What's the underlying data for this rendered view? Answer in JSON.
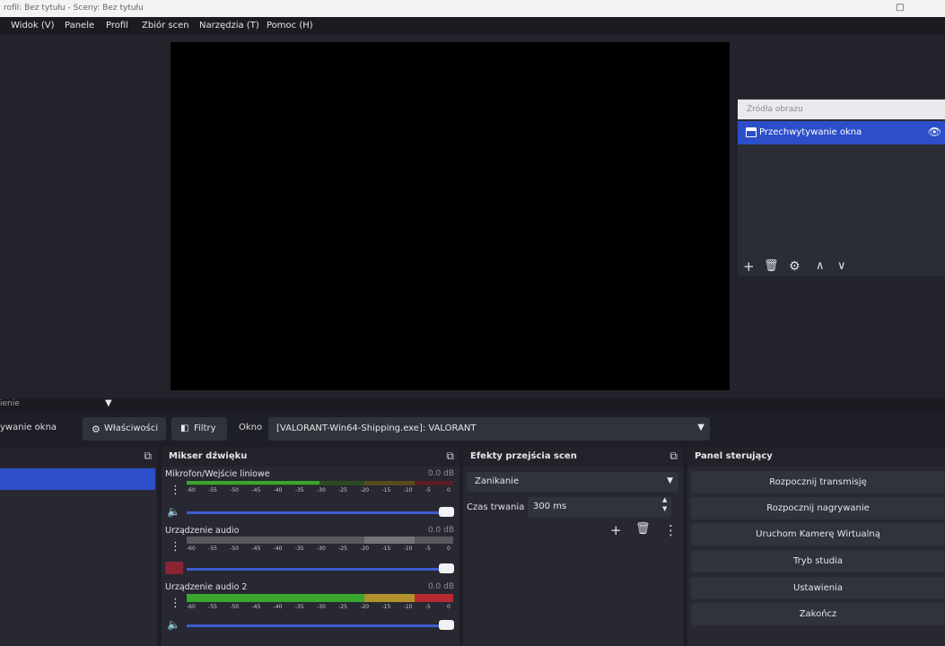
{
  "window": {
    "title": "rofil: Bez tytułu - Sceny: Bez tytułu",
    "minimize": "—",
    "maximize": "□"
  },
  "menu": [
    "Widok (V)",
    "Panele",
    "Profil",
    "Zbiór scen",
    "Narzędzia (T)",
    "Pomoc (H)"
  ],
  "sources": {
    "header": "Źródła obrazu",
    "items": [
      {
        "label": "Przechwytywanie okna",
        "icon": "window-icon",
        "selected": true
      }
    ],
    "tools": [
      "+",
      "🗑",
      "⚙",
      "∧",
      "∨"
    ]
  },
  "scene_strip": {
    "text": "ienie",
    "arrow": "▼"
  },
  "source_toolbar": {
    "source_name": "ywanie okna",
    "properties_label": "Właściwości",
    "filters_label": "Filtry",
    "window_label": "Okno",
    "window_value": "[VALORANT-Win64-Shipping.exe]: VALORANT"
  },
  "mixer": {
    "title": "Mikser dźwięku",
    "channels": [
      {
        "name": "Mikrofon/Wejście liniowe",
        "db": "0.0 dB",
        "level": 0.5,
        "muted": false
      },
      {
        "name": "Urządzenie audio",
        "db": "0.0 dB",
        "level": 0.0,
        "muted": true
      },
      {
        "name": "Urządzenie audio 2",
        "db": "0.0 dB",
        "level": 1.0,
        "muted": false
      }
    ],
    "scale": [
      "-60",
      "-55",
      "-50",
      "-45",
      "-40",
      "-35",
      "-30",
      "-25",
      "-20",
      "-15",
      "-10",
      "-5",
      "0"
    ],
    "volume": 1.0
  },
  "transitions": {
    "title": "Efekty przejścia scen",
    "selected": "Zanikanie",
    "duration_label": "Czas trwania",
    "duration_value": "300 ms"
  },
  "controls": {
    "title": "Panel sterujący",
    "buttons": [
      "Rozpocznij transmisję",
      "Rozpocznij nagrywanie",
      "Uruchom Kamerę Wirtualną",
      "Tryb studia",
      "Ustawienia",
      "Zakończ"
    ]
  },
  "colors": {
    "accent": "#2c4ec8",
    "meter_green": "#3aa52f",
    "meter_yellow": "#b2902b",
    "meter_red": "#b52b33",
    "volume_slider": "#3f5bd2"
  }
}
